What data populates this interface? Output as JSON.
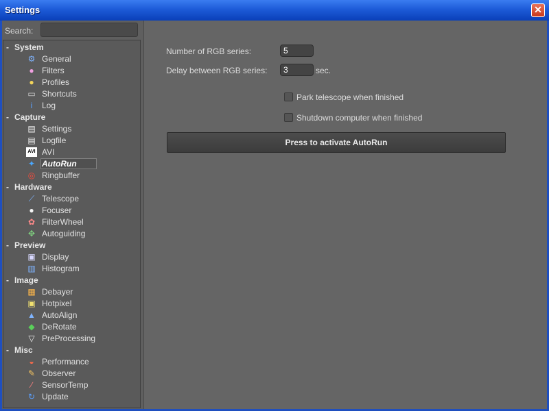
{
  "window": {
    "title": "Settings",
    "close_symbol": "✕"
  },
  "search": {
    "label": "Search:",
    "value": "",
    "placeholder": ""
  },
  "categories": [
    {
      "label": "System",
      "items": [
        {
          "label": "General",
          "icon": "gear-icon"
        },
        {
          "label": "Filters",
          "icon": "color-wheel-icon"
        },
        {
          "label": "Profiles",
          "icon": "pin-icon"
        },
        {
          "label": "Shortcuts",
          "icon": "keyboard-icon"
        },
        {
          "label": "Log",
          "icon": "info-icon"
        }
      ]
    },
    {
      "label": "Capture",
      "items": [
        {
          "label": "Settings",
          "icon": "document-icon"
        },
        {
          "label": "Logfile",
          "icon": "document-icon"
        },
        {
          "label": "AVI",
          "icon": "avi-icon",
          "icon_text": "AVI"
        },
        {
          "label": "AutoRun",
          "icon": "runner-icon",
          "selected": true
        },
        {
          "label": "Ringbuffer",
          "icon": "lifebuoy-icon"
        }
      ]
    },
    {
      "label": "Hardware",
      "items": [
        {
          "label": "Telescope",
          "icon": "telescope-icon"
        },
        {
          "label": "Focuser",
          "icon": "focuser-icon"
        },
        {
          "label": "FilterWheel",
          "icon": "filterwheel-icon"
        },
        {
          "label": "Autoguiding",
          "icon": "crosshair-icon"
        }
      ]
    },
    {
      "label": "Preview",
      "items": [
        {
          "label": "Display",
          "icon": "monitor-icon"
        },
        {
          "label": "Histogram",
          "icon": "histogram-icon"
        }
      ]
    },
    {
      "label": "Image",
      "items": [
        {
          "label": "Debayer",
          "icon": "grid-icon"
        },
        {
          "label": "Hotpixel",
          "icon": "hotpixel-icon"
        },
        {
          "label": "AutoAlign",
          "icon": "align-icon"
        },
        {
          "label": "DeRotate",
          "icon": "rotate-icon"
        },
        {
          "label": "PreProcessing",
          "icon": "funnel-icon"
        }
      ]
    },
    {
      "label": "Misc",
      "items": [
        {
          "label": "Performance",
          "icon": "gauge-icon"
        },
        {
          "label": "Observer",
          "icon": "pencil-icon"
        },
        {
          "label": "SensorTemp",
          "icon": "thermometer-icon"
        },
        {
          "label": "Update",
          "icon": "refresh-icon"
        }
      ]
    }
  ],
  "autorun": {
    "rgb_series_label": "Number of RGB series:",
    "rgb_series_value": "5",
    "delay_label": "Delay between RGB series:",
    "delay_value": "3",
    "delay_unit": "sec.",
    "park_label": "Park telescope when finished",
    "shutdown_label": "Shutdown computer when finished",
    "activate_button": "Press to activate AutoRun"
  }
}
